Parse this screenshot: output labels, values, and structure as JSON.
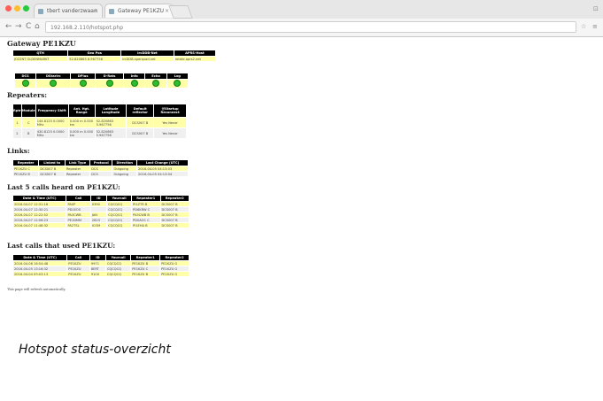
{
  "browser": {
    "tabs": [
      {
        "label": "tbert vanderzwaan"
      },
      {
        "label": "Gateway PE1KZU"
      }
    ],
    "url": "192.168.2.110/hotspot.php",
    "nav": {
      "back": "←",
      "forward": "→",
      "reload": "C",
      "home": "⌂"
    }
  },
  "page": {
    "title": "Gateway PE1KZU",
    "info_table": {
      "headers": [
        "QTH",
        "Geo Pos",
        "IrcDDB-Net",
        "APRS-Host"
      ],
      "rows": [
        [
          "JO22NT OLDENMARKT",
          "52.820863 6.967756",
          "ircDDB-sparquad.net",
          "rotate.aprs2.net"
        ]
      ]
    },
    "status_table": {
      "headers": [
        "DCS",
        "DStarIrc",
        "DPlus",
        "D-Rats",
        "Info",
        "Echo",
        "Log"
      ]
    },
    "repeaters_title": "Repeaters:",
    "repeaters_table": {
      "headers": [
        "Rptr",
        "Module",
        "Frequency Shift",
        "Ant. Hgt. Range",
        "Latitude Longitude",
        "Default reflector",
        "@Startup Reconnect"
      ],
      "rows": [
        [
          "1",
          "C",
          "144.8125 0.0000 MHz",
          "0.000 m 0.000 km",
          "52.820863 5.967756",
          "DCS007 B",
          "Yes Never"
        ],
        [
          "2",
          "B",
          "430.8125 0.0000 MHz",
          "0.000 m 0.000 km",
          "52.820863 5.967756",
          "DCS007 B",
          "Yes Never"
        ]
      ]
    },
    "links_title": "Links:",
    "links_table": {
      "headers": [
        "Repeater",
        "Linked to",
        "Link Type",
        "Protocol",
        "Direction",
        "Last Change (UTC)"
      ],
      "rows": [
        [
          "PE1KZU C",
          "DCS007 B",
          "Repeater",
          "DCS",
          "Outgoing",
          "2016-04-05 04:13:03"
        ],
        [
          "PE1KZU B",
          "DCS007 B",
          "Repeater",
          "DCS",
          "Outgoing",
          "2016-04-05 04:13:04"
        ]
      ]
    },
    "heard_title": "Last 5 calls heard on PE1KZU:",
    "heard_table": {
      "headers": [
        "Date & Time (UTC)",
        "Call",
        "ID",
        "Yourcall",
        "Repeater1",
        "Repeater2"
      ],
      "rows": [
        [
          "2016-04-07 12:31:16",
          "PA0P",
          "0390",
          "CQCQCQ",
          "PI1ZTR B",
          "DCS007 B"
        ],
        [
          "2016-04-07 12:30:21",
          "PD1EOS",
          "",
          "CQCQCQ",
          "PD6KRW C",
          "DCS007 B"
        ],
        [
          "2016-04-07 12:22:52",
          "PA3CWB",
          "JAN",
          "CQCQCQ",
          "PA3CWB B",
          "DCS007 B"
        ],
        [
          "2016-04-07 12:06:23",
          "PE1NMM",
          "2823",
          "CQCQCQ",
          "PD0AOC C",
          "DCS007 B"
        ],
        [
          "2016-04-07 11:48:32",
          "PA2TSL",
          "ICOM",
          "CQCQCQ",
          "PI1EHA B",
          "DCS007 B"
        ]
      ]
    },
    "used_title": "Last calls that used PE1KZU:",
    "used_table": {
      "headers": [
        "Date & Time (UTC)",
        "Call",
        "ID",
        "Yourcall",
        "Repeater1",
        "Repeater2"
      ],
      "rows": [
        [
          "2016-04-06 16:54:48",
          "PE1KZU",
          "9971",
          "CQCQCQ",
          "PE1KZU B",
          "PE1KZU G"
        ],
        [
          "2016-04-05 13:16:32",
          "PE1KZU",
          "8ERT",
          "CQCQCQ",
          "PE1KZU C",
          "PE1KZU G"
        ],
        [
          "2016-04-04 09:03:13",
          "PE1KZU",
          "9100",
          "CQCQCQ",
          "PE1KZU B",
          "PE1KZU G"
        ]
      ]
    },
    "refresh_note": "This page will refresh automatically.",
    "caption": "Hotspot status-overzicht"
  },
  "colors": {
    "header_bg": "#000000",
    "row_yellow": "#ffffaa",
    "led_green": "#2bbd2b"
  }
}
